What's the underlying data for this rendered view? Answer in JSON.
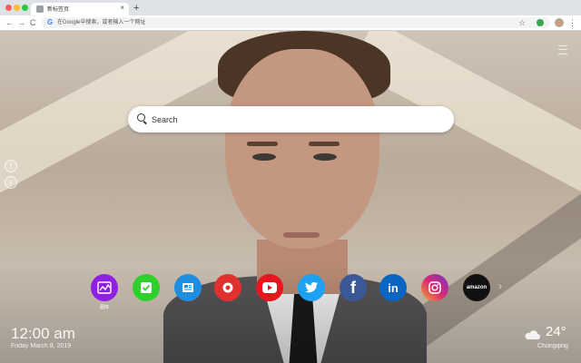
{
  "browser": {
    "tab_title": "新标签页",
    "tab_close": "×",
    "new_tab": "+",
    "back": "←",
    "forward": "→",
    "reload": "C",
    "address_g": "G",
    "address_placeholder": "在Google中搜索，或者输入一个网址",
    "star": "☆",
    "menu": "⋮"
  },
  "search": {
    "placeholder": "Search"
  },
  "social": {
    "facebook": "f",
    "twitter": "t"
  },
  "shortcuts": [
    {
      "id": "gallery",
      "label": "图库",
      "color": "#8e1fe3",
      "glyph": ""
    },
    {
      "id": "tasks",
      "label": "",
      "color": "#2ed12b",
      "glyph": ""
    },
    {
      "id": "news",
      "label": "",
      "color": "#1f8ee0",
      "glyph": ""
    },
    {
      "id": "games",
      "label": "",
      "color": "#e1312f",
      "glyph": ""
    },
    {
      "id": "youtube",
      "label": "",
      "color": "#e5171d",
      "glyph": ""
    },
    {
      "id": "twitter",
      "label": "",
      "color": "#1da1f2",
      "glyph": ""
    },
    {
      "id": "facebook",
      "label": "",
      "color": "#3b5998",
      "glyph": "f"
    },
    {
      "id": "linkedin",
      "label": "",
      "color": "#0a66c2",
      "glyph": "in"
    },
    {
      "id": "instagram",
      "label": "",
      "color": "#d62976",
      "glyph": ""
    },
    {
      "id": "amazon",
      "label": "",
      "color": "#111111",
      "glyph": "amazon"
    }
  ],
  "next": "›",
  "clock": {
    "time": "12:00 am",
    "date": "Friday March 8, 2019"
  },
  "weather": {
    "temperature": "24°",
    "city": "Chongqing"
  }
}
